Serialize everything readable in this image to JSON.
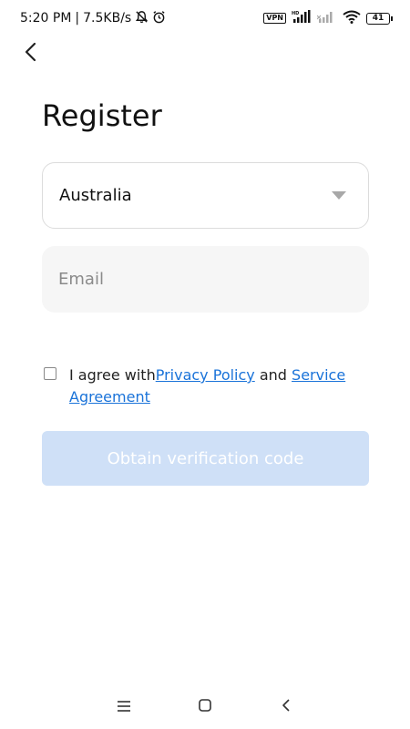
{
  "status_bar": {
    "time": "5:20 PM",
    "separator": "|",
    "net_speed": "7.5KB/s",
    "vpn": "VPN",
    "hd": "HD",
    "battery": "41"
  },
  "page": {
    "title": "Register"
  },
  "form": {
    "country": {
      "value": "Australia"
    },
    "email": {
      "value": "",
      "placeholder": "Email"
    },
    "agreement": {
      "prefix": "I agree with",
      "privacy_link": "Privacy Policy",
      "conjunction": " and ",
      "service_link": "Service Agreement",
      "checked": false
    },
    "submit_label": "Obtain verification code"
  },
  "colors": {
    "accent": "#1a73d9",
    "button_disabled": "#cfe0f7",
    "field_bg": "#f6f6f6"
  },
  "icons": {
    "back": "chevron-left-icon",
    "dropdown": "caret-down-icon",
    "nav": [
      "menu-icon",
      "home-square-icon",
      "back-triangle-icon"
    ]
  }
}
